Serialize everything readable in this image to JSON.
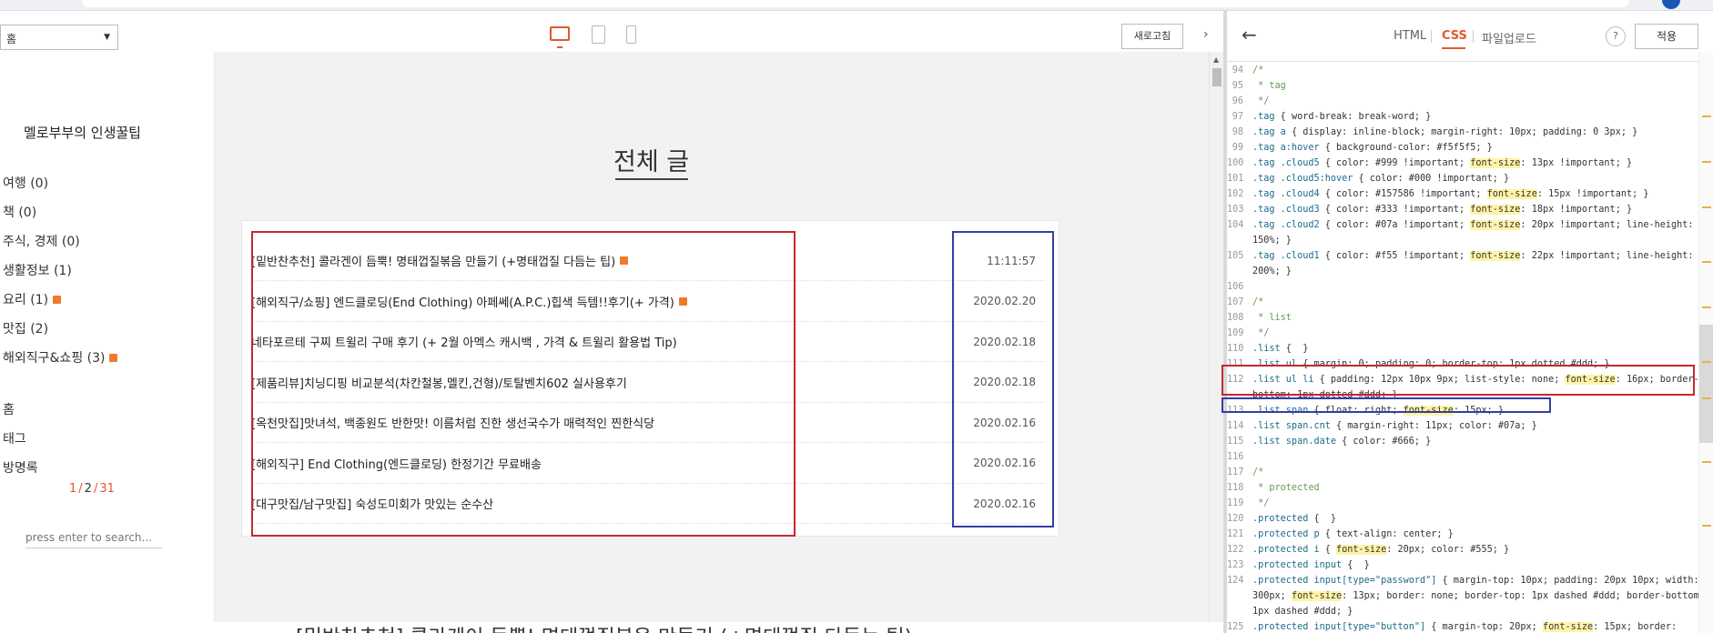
{
  "preview": {
    "page_select": "홈",
    "refresh_label": "새로고침",
    "blog_title": "멜로부부의 인생꿀팁",
    "categories": [
      {
        "label": "여행 (0)",
        "new": false
      },
      {
        "label": "책 (0)",
        "new": false
      },
      {
        "label": "주식, 경제 (0)",
        "new": false
      },
      {
        "label": "생활정보 (1)",
        "new": false
      },
      {
        "label": "요리 (1)",
        "new": true
      },
      {
        "label": "맛집 (2)",
        "new": false
      },
      {
        "label": "해외직구&쇼핑 (3)",
        "new": true
      }
    ],
    "nav": [
      "홈",
      "태그",
      "방명록"
    ],
    "pager": {
      "current": "1",
      "p2": "2",
      "p3": "31"
    },
    "search_placeholder": "press enter to search...",
    "section_title": "전체 글",
    "posts": [
      {
        "title": "[밑반찬추천] 콜라겐이 듬뿍! 명태껍질볶음 만들기 (+명태껍질 다듬는 팁)",
        "date": "11:11:57",
        "new": true
      },
      {
        "title": "[해외직구/쇼핑] 엔드클로딩(End Clothing) 아페쎄(A.P.C.)힙색 득템!!후기(+ 가격)",
        "date": "2020.02.20",
        "new": true
      },
      {
        "title": "네타포르테 구찌 트윌리 구매 후기 (+ 2월 아멕스 캐시백 , 가격 & 트윌리 활용법 Tip)",
        "date": "2020.02.18",
        "new": false
      },
      {
        "title": "[제품리뷰]치닝디핑 비교분석(차칸철봉,멜킨,건형)/토탈벤치602 실사용후기",
        "date": "2020.02.18",
        "new": false
      },
      {
        "title": "[옥천맛집]맛녀석, 백종원도 반한맛! 이름처럼 진한 생선국수가 매력적인 찐한식당",
        "date": "2020.02.16",
        "new": false
      },
      {
        "title": "[해외직구] End Clothing(엔드클로딩) 한정기간 무료배송",
        "date": "2020.02.16",
        "new": false
      },
      {
        "title": "[대구맛집/남구맛집] 숙성도미회가 맛있는 순수산",
        "date": "2020.02.16",
        "new": false
      }
    ],
    "bottom_title": "[밑반찬추천] 콜라겐이 듬뿍! 명태껍질볶음 만들기 (+명태껍질 다듬는 팁)"
  },
  "editor": {
    "tabs": {
      "html": "HTML",
      "css": "CSS",
      "upload": "파일업로드"
    },
    "help_label": "?",
    "apply_label": "적용",
    "lines": [
      {
        "n": "94",
        "parts": [
          {
            "t": "/*",
            "c": "cmt"
          }
        ]
      },
      {
        "n": "95",
        "parts": [
          {
            "t": " * tag",
            "c": "cmt"
          }
        ]
      },
      {
        "n": "96",
        "parts": [
          {
            "t": " */",
            "c": "cmt"
          }
        ]
      },
      {
        "n": "97",
        "parts": [
          {
            "t": ".tag",
            "c": "sel"
          },
          {
            "t": " { word-break: break-word; }",
            "c": "prop"
          }
        ]
      },
      {
        "n": "98",
        "parts": [
          {
            "t": ".tag a",
            "c": "sel"
          },
          {
            "t": " { display: inline-block; margin-right: 10px; padding: 0 3px; }",
            "c": "prop"
          }
        ]
      },
      {
        "n": "99",
        "parts": [
          {
            "t": ".tag a:hover",
            "c": "sel"
          },
          {
            "t": " { background-color: #f5f5f5; }",
            "c": "prop"
          }
        ]
      },
      {
        "n": "100",
        "parts": [
          {
            "t": ".tag .cloud5",
            "c": "sel"
          },
          {
            "t": " { color: #999 !important; ",
            "c": "prop"
          },
          {
            "t": "font-size",
            "c": "hl"
          },
          {
            "t": ": 13px !important; }",
            "c": "prop"
          }
        ]
      },
      {
        "n": "101",
        "parts": [
          {
            "t": ".tag .cloud5:hover",
            "c": "sel"
          },
          {
            "t": " { color: #000 !important; }",
            "c": "prop"
          }
        ]
      },
      {
        "n": "102",
        "parts": [
          {
            "t": ".tag .cloud4",
            "c": "sel"
          },
          {
            "t": " { color: #157586 !important; ",
            "c": "prop"
          },
          {
            "t": "font-size",
            "c": "hl"
          },
          {
            "t": ": 15px !important; }",
            "c": "prop"
          }
        ]
      },
      {
        "n": "103",
        "parts": [
          {
            "t": ".tag .cloud3",
            "c": "sel"
          },
          {
            "t": " { color: #333 !important; ",
            "c": "prop"
          },
          {
            "t": "font-size",
            "c": "hl"
          },
          {
            "t": ": 18px !important; }",
            "c": "prop"
          }
        ]
      },
      {
        "n": "104",
        "parts": [
          {
            "t": ".tag .cloud2",
            "c": "sel"
          },
          {
            "t": " { color: #07a !important; ",
            "c": "prop"
          },
          {
            "t": "font-size",
            "c": "hl"
          },
          {
            "t": ": 20px !important; line-height:",
            "c": "prop"
          }
        ]
      },
      {
        "n": "",
        "parts": [
          {
            "t": "150%; }",
            "c": "prop"
          }
        ]
      },
      {
        "n": "105",
        "parts": [
          {
            "t": ".tag .cloud1",
            "c": "sel"
          },
          {
            "t": " { color: #f55 !important; ",
            "c": "prop"
          },
          {
            "t": "font-size",
            "c": "hl"
          },
          {
            "t": ": 22px !important; line-height:",
            "c": "prop"
          }
        ]
      },
      {
        "n": "",
        "parts": [
          {
            "t": "200%; }",
            "c": "prop"
          }
        ]
      },
      {
        "n": "106",
        "parts": [
          {
            "t": "",
            "c": "prop"
          }
        ]
      },
      {
        "n": "107",
        "parts": [
          {
            "t": "/*",
            "c": "cmt"
          }
        ]
      },
      {
        "n": "108",
        "parts": [
          {
            "t": " * list",
            "c": "cmt"
          }
        ]
      },
      {
        "n": "109",
        "parts": [
          {
            "t": " */",
            "c": "cmt"
          }
        ]
      },
      {
        "n": "110",
        "parts": [
          {
            "t": ".list",
            "c": "sel"
          },
          {
            "t": " {  }",
            "c": "prop"
          }
        ]
      },
      {
        "n": "111",
        "parts": [
          {
            "t": ".list ul",
            "c": "sel"
          },
          {
            "t": " { margin: 0; padding: 0; border-top: 1px dotted #ddd; }",
            "c": "prop"
          }
        ]
      },
      {
        "n": "112",
        "parts": [
          {
            "t": ".list ul li",
            "c": "sel"
          },
          {
            "t": " { padding: 12px 10px 9px; list-style: none; ",
            "c": "prop"
          },
          {
            "t": "font-size",
            "c": "hl"
          },
          {
            "t": ": 16px; border-",
            "c": "prop"
          }
        ]
      },
      {
        "n": "",
        "parts": [
          {
            "t": "bottom: 1px dotted #ddd; }",
            "c": "prop"
          }
        ]
      },
      {
        "n": "113",
        "parts": [
          {
            "t": ".list span",
            "c": "sel"
          },
          {
            "t": " { float: right; ",
            "c": "prop"
          },
          {
            "t": "font-size",
            "c": "hl"
          },
          {
            "t": ": 15px; }",
            "c": "prop"
          }
        ]
      },
      {
        "n": "114",
        "parts": [
          {
            "t": ".list span.cnt",
            "c": "sel"
          },
          {
            "t": " { margin-right: 11px; color: #07a; }",
            "c": "prop"
          }
        ]
      },
      {
        "n": "115",
        "parts": [
          {
            "t": ".list span.date",
            "c": "sel"
          },
          {
            "t": " { color: #666; }",
            "c": "prop"
          }
        ]
      },
      {
        "n": "116",
        "parts": [
          {
            "t": "",
            "c": "prop"
          }
        ]
      },
      {
        "n": "117",
        "parts": [
          {
            "t": "/*",
            "c": "cmt"
          }
        ]
      },
      {
        "n": "118",
        "parts": [
          {
            "t": " * protected",
            "c": "cmt"
          }
        ]
      },
      {
        "n": "119",
        "parts": [
          {
            "t": " */",
            "c": "cmt"
          }
        ]
      },
      {
        "n": "120",
        "parts": [
          {
            "t": ".protected",
            "c": "sel"
          },
          {
            "t": " {  }",
            "c": "prop"
          }
        ]
      },
      {
        "n": "121",
        "parts": [
          {
            "t": ".protected p",
            "c": "sel"
          },
          {
            "t": " { text-align: center; }",
            "c": "prop"
          }
        ]
      },
      {
        "n": "122",
        "parts": [
          {
            "t": ".protected i",
            "c": "sel"
          },
          {
            "t": " { ",
            "c": "prop"
          },
          {
            "t": "font-size",
            "c": "hl"
          },
          {
            "t": ": 20px; color: #555; }",
            "c": "prop"
          }
        ]
      },
      {
        "n": "123",
        "parts": [
          {
            "t": ".protected input",
            "c": "sel"
          },
          {
            "t": " {  }",
            "c": "prop"
          }
        ]
      },
      {
        "n": "124",
        "parts": [
          {
            "t": ".protected input[type=\"password\"]",
            "c": "sel"
          },
          {
            "t": " { margin-top: 10px; padding: 20px 10px; width:",
            "c": "prop"
          }
        ]
      },
      {
        "n": "",
        "parts": [
          {
            "t": "300px; ",
            "c": "prop"
          },
          {
            "t": "font-size",
            "c": "hl"
          },
          {
            "t": ": 13px; border: none; border-top: 1px dashed #ddd; border-bottom:",
            "c": "prop"
          }
        ]
      },
      {
        "n": "",
        "parts": [
          {
            "t": "1px dashed #ddd; }",
            "c": "prop"
          }
        ]
      },
      {
        "n": "125",
        "parts": [
          {
            "t": ".protected input[type=\"button\"]",
            "c": "sel"
          },
          {
            "t": " { margin-top: 20px; ",
            "c": "prop"
          },
          {
            "t": "font-size",
            "c": "hl"
          },
          {
            "t": ": 15px; border:",
            "c": "prop"
          }
        ]
      }
    ]
  }
}
